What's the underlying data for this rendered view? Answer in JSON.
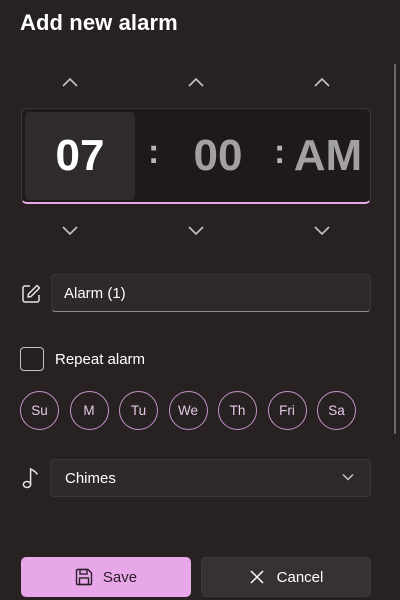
{
  "dialog": {
    "title": "Add new alarm"
  },
  "time": {
    "hour": "07",
    "separator": ":",
    "minute": "00",
    "period": "AM"
  },
  "alarm_name": {
    "value": "Alarm (1)"
  },
  "repeat": {
    "label": "Repeat alarm",
    "checked": false
  },
  "days": [
    "Su",
    "M",
    "Tu",
    "We",
    "Th",
    "Fri",
    "Sa"
  ],
  "sound": {
    "selected": "Chimes"
  },
  "actions": {
    "save_label": "Save",
    "cancel_label": "Cancel"
  },
  "colors": {
    "accent": "#e7a7e9",
    "background": "#272121",
    "day_border": "#c493c8"
  },
  "icons": [
    "chevron-up-icon",
    "chevron-down-icon",
    "edit-icon",
    "music-note-icon",
    "save-icon",
    "close-icon"
  ]
}
